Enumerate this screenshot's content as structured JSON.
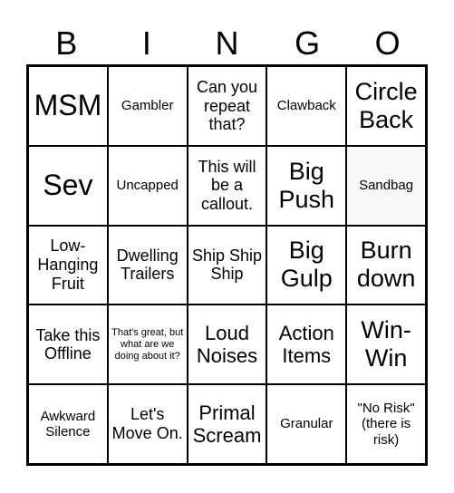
{
  "header": [
    "B",
    "I",
    "N",
    "G",
    "O"
  ],
  "cells": [
    {
      "text": "MSM",
      "size": "xxl"
    },
    {
      "text": "Gambler",
      "size": "sm"
    },
    {
      "text": "Can you repeat that?",
      "size": "md"
    },
    {
      "text": "Clawback",
      "size": "sm"
    },
    {
      "text": "Circle Back",
      "size": "xl"
    },
    {
      "text": "Sev",
      "size": "xxl"
    },
    {
      "text": "Uncapped",
      "size": "sm"
    },
    {
      "text": "This will be a callout.",
      "size": "md"
    },
    {
      "text": "Big Push",
      "size": "xl"
    },
    {
      "text": "Sandbag",
      "size": "sm",
      "free": true
    },
    {
      "text": "Low-Hanging Fruit",
      "size": "md"
    },
    {
      "text": "Dwelling Trailers",
      "size": "md"
    },
    {
      "text": "Ship Ship Ship",
      "size": "md"
    },
    {
      "text": "Big Gulp",
      "size": "xl"
    },
    {
      "text": "Burn down",
      "size": "xl"
    },
    {
      "text": "Take this Offline",
      "size": "md"
    },
    {
      "text": "That's great, but what are we doing about it?",
      "size": "xs"
    },
    {
      "text": "Loud Noises",
      "size": "lg"
    },
    {
      "text": "Action Items",
      "size": "lg"
    },
    {
      "text": "Win-Win",
      "size": "xl"
    },
    {
      "text": "Awkward Silence",
      "size": "sm"
    },
    {
      "text": "Let's Move On.",
      "size": "md"
    },
    {
      "text": "Primal Scream",
      "size": "lg"
    },
    {
      "text": "Granular",
      "size": "sm"
    },
    {
      "text": "\"No Risk\" (there is risk)",
      "size": "sm"
    }
  ]
}
